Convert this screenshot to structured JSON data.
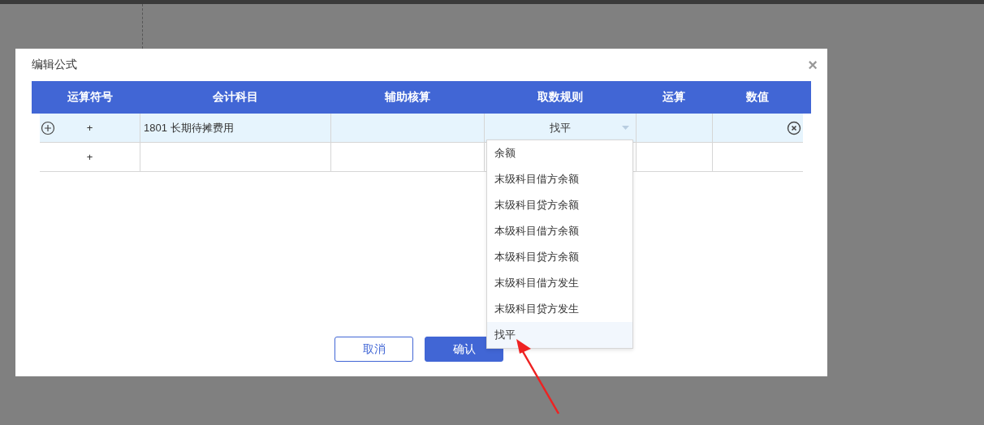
{
  "dialog": {
    "title": "编辑公式",
    "close": "×"
  },
  "table": {
    "columns": [
      "运算符号",
      "会计科目",
      "辅助核算",
      "取数规则",
      "运算",
      "数值"
    ],
    "rows": [
      {
        "selected": true,
        "operator": "+",
        "account": "1801 长期待摊费用",
        "rule": "找平"
      },
      {
        "selected": false,
        "operator": "+"
      }
    ]
  },
  "dropdown": {
    "options": [
      {
        "label": "余额",
        "highlighted": false
      },
      {
        "label": "末级科目借方余额",
        "highlighted": false
      },
      {
        "label": "末级科目贷方余额",
        "highlighted": false
      },
      {
        "label": "本级科目借方余额",
        "highlighted": false
      },
      {
        "label": "本级科目贷方余额",
        "highlighted": false
      },
      {
        "label": "末级科目借方发生",
        "highlighted": false
      },
      {
        "label": "末级科目贷方发生",
        "highlighted": false
      },
      {
        "label": "找平",
        "highlighted": true
      }
    ]
  },
  "buttons": [
    {
      "label": "取消",
      "kind": "secondary"
    },
    {
      "label": "确认",
      "kind": "primary"
    }
  ]
}
